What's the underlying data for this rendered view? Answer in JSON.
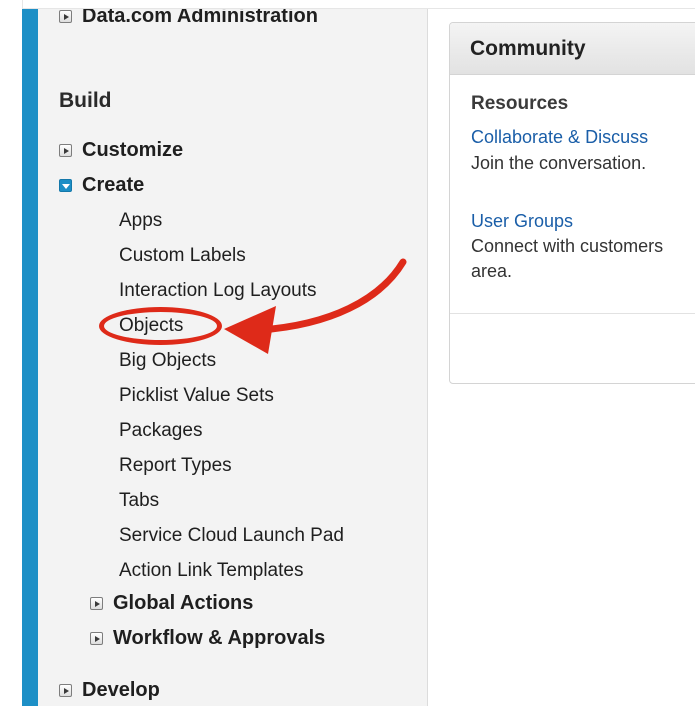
{
  "sidebar": {
    "top_item": "Data.com Administration",
    "build_title": "Build",
    "customize": "Customize",
    "create": "Create",
    "create_items": [
      "Apps",
      "Custom Labels",
      "Interaction Log Layouts",
      "Objects",
      "Big Objects",
      "Picklist Value Sets",
      "Packages",
      "Report Types",
      "Tabs",
      "Service Cloud Launch Pad",
      "Action Link Templates"
    ],
    "global_actions": "Global Actions",
    "workflow": "Workflow & Approvals",
    "develop": "Develop"
  },
  "community": {
    "title": "Community",
    "resources_title": "Resources",
    "links": [
      {
        "label": "Collaborate & Discuss",
        "description": "Join the conversation."
      },
      {
        "label": "User Groups",
        "description": "Connect with customers",
        "description_2": "area."
      }
    ]
  },
  "annotation": {
    "color": "#de2a19",
    "highlighted": "Objects"
  },
  "colors": {
    "accent": "#1d8fc6",
    "link": "#1a5ea8"
  }
}
